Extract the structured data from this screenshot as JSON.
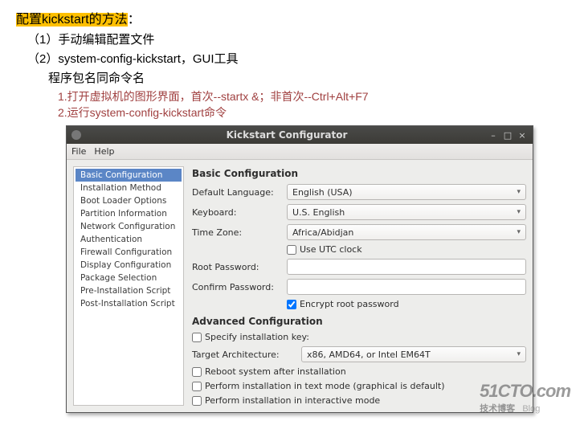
{
  "doc": {
    "title_hl": "配置kickstart的方法",
    "title_tail": "：",
    "line1": "（1）手动编辑配置文件",
    "line2": "（2）system-config-kickstart，GUI工具",
    "line3": "程序包名同命令名",
    "sub1": "1.打开虚拟机的图形界面，首次--startx &；非首次--Ctrl+Alt+F7",
    "sub2": "2.运行system-config-kickstart命令"
  },
  "window": {
    "title": "Kickstart Configurator",
    "menu": {
      "file": "File",
      "help": "Help"
    },
    "sidebar": [
      "Basic Configuration",
      "Installation Method",
      "Boot Loader Options",
      "Partition Information",
      "Network Configuration",
      "Authentication",
      "Firewall Configuration",
      "Display Configuration",
      "Package Selection",
      "Pre-Installation Script",
      "Post-Installation Script"
    ],
    "basic": {
      "section": "Basic Configuration",
      "lang_lbl": "Default Language:",
      "lang_val": "English (USA)",
      "kbd_lbl": "Keyboard:",
      "kbd_val": "U.S. English",
      "tz_lbl": "Time Zone:",
      "tz_val": "Africa/Abidjan",
      "utc_lbl": "Use UTC clock",
      "root_lbl": "Root Password:",
      "conf_lbl": "Confirm Password:",
      "encrypt_lbl": "Encrypt root password"
    },
    "adv": {
      "section": "Advanced Configuration",
      "spec_lbl": "Specify installation key:",
      "arch_lbl": "Target Architecture:",
      "arch_val": "x86, AMD64, or Intel EM64T",
      "reboot_lbl": "Reboot system after installation",
      "textmode_lbl": "Perform installation in text mode (graphical is default)",
      "interactive_lbl": "Perform installation in interactive mode"
    }
  },
  "watermark": {
    "main": "51CTO.com",
    "sub_cn": "技术博客",
    "sub_en": "Blog"
  }
}
